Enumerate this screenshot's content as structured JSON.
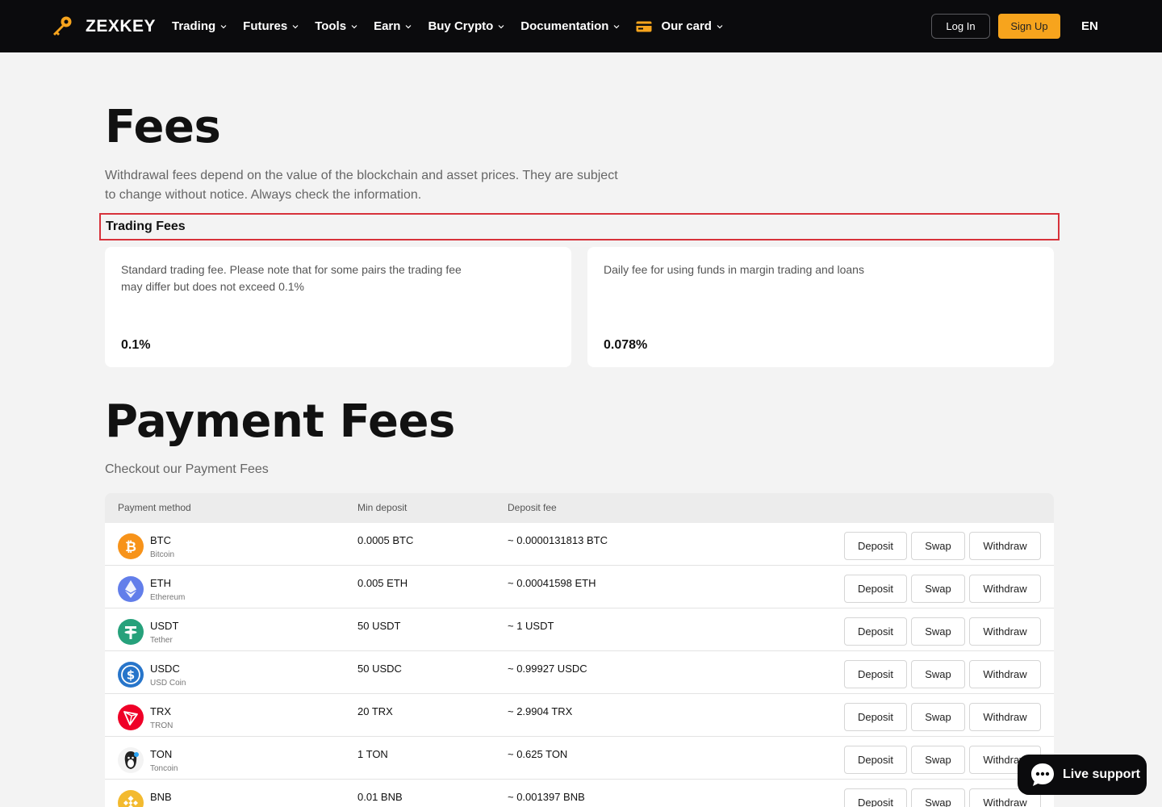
{
  "nav": {
    "brand": "ZEXKEY",
    "items": [
      {
        "label": "Trading"
      },
      {
        "label": "Futures"
      },
      {
        "label": "Tools"
      },
      {
        "label": "Earn"
      },
      {
        "label": "Buy Crypto"
      },
      {
        "label": "Documentation"
      },
      {
        "label": "Our card"
      }
    ],
    "login": "Log In",
    "signup": "Sign Up",
    "lang": "EN"
  },
  "fees": {
    "title": "Fees",
    "description": "Withdrawal fees depend on the value of the blockchain and asset prices. They are subject to change without notice. Always check the information.",
    "trading_title": "Trading Fees",
    "cards": [
      {
        "text": "Standard trading fee. Please note that for some pairs the trading fee may differ but does not exceed 0.1%",
        "value": "0.1%"
      },
      {
        "text": "Daily fee for using funds in margin trading and loans",
        "value": "0.078%"
      }
    ]
  },
  "payment": {
    "title": "Payment Fees",
    "subtitle": "Checkout our Payment Fees",
    "headers": {
      "method": "Payment method",
      "min": "Min deposit",
      "fee": "Deposit fee"
    },
    "actions": {
      "deposit": "Deposit",
      "swap": "Swap",
      "withdraw": "Withdraw"
    },
    "rows": [
      {
        "symbol": "BTC",
        "name": "Bitcoin",
        "min": "0.0005 BTC",
        "fee": "~ 0.0000131813 BTC",
        "icon": "bitcoin-icon",
        "color": "#f7931a"
      },
      {
        "symbol": "ETH",
        "name": "Ethereum",
        "min": "0.005 ETH",
        "fee": "~ 0.00041598 ETH",
        "icon": "ethereum-icon",
        "color": "#627eea"
      },
      {
        "symbol": "USDT",
        "name": "Tether",
        "min": "50 USDT",
        "fee": "~ 1 USDT",
        "icon": "tether-icon",
        "color": "#26a17b"
      },
      {
        "symbol": "USDC",
        "name": "USD Coin",
        "min": "50 USDC",
        "fee": "~ 0.99927 USDC",
        "icon": "usdc-icon",
        "color": "#2775ca"
      },
      {
        "symbol": "TRX",
        "name": "TRON",
        "min": "20 TRX",
        "fee": "~ 2.9904 TRX",
        "icon": "tron-icon",
        "color": "#ef0027"
      },
      {
        "symbol": "TON",
        "name": "Toncoin",
        "min": "1 TON",
        "fee": "~ 0.625 TON",
        "icon": "toncoin-icon",
        "color": "#222222"
      },
      {
        "symbol": "BNB",
        "name": "",
        "min": "0.01 BNB",
        "fee": "~ 0.001397 BNB",
        "icon": "bnb-icon",
        "color": "#f3ba2f"
      }
    ]
  },
  "live_support": "Live support",
  "colors": {
    "accent": "#f7a41d",
    "nav_bg": "#0b0b0d",
    "highlight": "#d7313a"
  }
}
